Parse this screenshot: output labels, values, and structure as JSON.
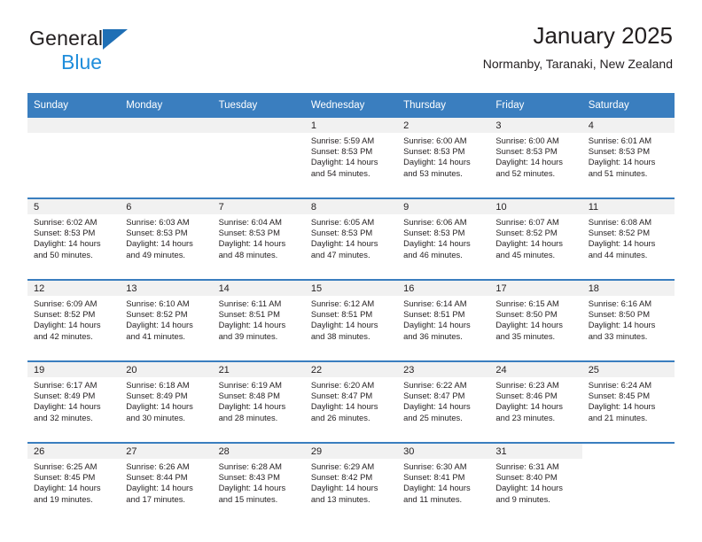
{
  "brand": {
    "line1": "General",
    "line2": "Blue",
    "triangle_color": "#1f6fb5",
    "blue_text_color": "#1f8ddb"
  },
  "header": {
    "title": "January 2025",
    "location": "Normanby, Taranaki, New Zealand"
  },
  "theme": {
    "header_blue": "#3a7ebf",
    "daynum_band": "#f1f1f1",
    "divider_blue": "#3a7ebf"
  },
  "weekday_headers": [
    "Sunday",
    "Monday",
    "Tuesday",
    "Wednesday",
    "Thursday",
    "Friday",
    "Saturday"
  ],
  "labels": {
    "sunrise_prefix": "Sunrise:",
    "sunset_prefix": "Sunset:",
    "daylight_prefix": "Daylight:"
  },
  "weeks": [
    [
      {
        "empty": true
      },
      {
        "empty": true
      },
      {
        "empty": true
      },
      {
        "day": "1",
        "sunrise": "Sunrise: 5:59 AM",
        "sunset": "Sunset: 8:53 PM",
        "daylight_1": "Daylight: 14 hours",
        "daylight_2": "and 54 minutes."
      },
      {
        "day": "2",
        "sunrise": "Sunrise: 6:00 AM",
        "sunset": "Sunset: 8:53 PM",
        "daylight_1": "Daylight: 14 hours",
        "daylight_2": "and 53 minutes."
      },
      {
        "day": "3",
        "sunrise": "Sunrise: 6:00 AM",
        "sunset": "Sunset: 8:53 PM",
        "daylight_1": "Daylight: 14 hours",
        "daylight_2": "and 52 minutes."
      },
      {
        "day": "4",
        "sunrise": "Sunrise: 6:01 AM",
        "sunset": "Sunset: 8:53 PM",
        "daylight_1": "Daylight: 14 hours",
        "daylight_2": "and 51 minutes."
      }
    ],
    [
      {
        "day": "5",
        "sunrise": "Sunrise: 6:02 AM",
        "sunset": "Sunset: 8:53 PM",
        "daylight_1": "Daylight: 14 hours",
        "daylight_2": "and 50 minutes."
      },
      {
        "day": "6",
        "sunrise": "Sunrise: 6:03 AM",
        "sunset": "Sunset: 8:53 PM",
        "daylight_1": "Daylight: 14 hours",
        "daylight_2": "and 49 minutes."
      },
      {
        "day": "7",
        "sunrise": "Sunrise: 6:04 AM",
        "sunset": "Sunset: 8:53 PM",
        "daylight_1": "Daylight: 14 hours",
        "daylight_2": "and 48 minutes."
      },
      {
        "day": "8",
        "sunrise": "Sunrise: 6:05 AM",
        "sunset": "Sunset: 8:53 PM",
        "daylight_1": "Daylight: 14 hours",
        "daylight_2": "and 47 minutes."
      },
      {
        "day": "9",
        "sunrise": "Sunrise: 6:06 AM",
        "sunset": "Sunset: 8:53 PM",
        "daylight_1": "Daylight: 14 hours",
        "daylight_2": "and 46 minutes."
      },
      {
        "day": "10",
        "sunrise": "Sunrise: 6:07 AM",
        "sunset": "Sunset: 8:52 PM",
        "daylight_1": "Daylight: 14 hours",
        "daylight_2": "and 45 minutes."
      },
      {
        "day": "11",
        "sunrise": "Sunrise: 6:08 AM",
        "sunset": "Sunset: 8:52 PM",
        "daylight_1": "Daylight: 14 hours",
        "daylight_2": "and 44 minutes."
      }
    ],
    [
      {
        "day": "12",
        "sunrise": "Sunrise: 6:09 AM",
        "sunset": "Sunset: 8:52 PM",
        "daylight_1": "Daylight: 14 hours",
        "daylight_2": "and 42 minutes."
      },
      {
        "day": "13",
        "sunrise": "Sunrise: 6:10 AM",
        "sunset": "Sunset: 8:52 PM",
        "daylight_1": "Daylight: 14 hours",
        "daylight_2": "and 41 minutes."
      },
      {
        "day": "14",
        "sunrise": "Sunrise: 6:11 AM",
        "sunset": "Sunset: 8:51 PM",
        "daylight_1": "Daylight: 14 hours",
        "daylight_2": "and 39 minutes."
      },
      {
        "day": "15",
        "sunrise": "Sunrise: 6:12 AM",
        "sunset": "Sunset: 8:51 PM",
        "daylight_1": "Daylight: 14 hours",
        "daylight_2": "and 38 minutes."
      },
      {
        "day": "16",
        "sunrise": "Sunrise: 6:14 AM",
        "sunset": "Sunset: 8:51 PM",
        "daylight_1": "Daylight: 14 hours",
        "daylight_2": "and 36 minutes."
      },
      {
        "day": "17",
        "sunrise": "Sunrise: 6:15 AM",
        "sunset": "Sunset: 8:50 PM",
        "daylight_1": "Daylight: 14 hours",
        "daylight_2": "and 35 minutes."
      },
      {
        "day": "18",
        "sunrise": "Sunrise: 6:16 AM",
        "sunset": "Sunset: 8:50 PM",
        "daylight_1": "Daylight: 14 hours",
        "daylight_2": "and 33 minutes."
      }
    ],
    [
      {
        "day": "19",
        "sunrise": "Sunrise: 6:17 AM",
        "sunset": "Sunset: 8:49 PM",
        "daylight_1": "Daylight: 14 hours",
        "daylight_2": "and 32 minutes."
      },
      {
        "day": "20",
        "sunrise": "Sunrise: 6:18 AM",
        "sunset": "Sunset: 8:49 PM",
        "daylight_1": "Daylight: 14 hours",
        "daylight_2": "and 30 minutes."
      },
      {
        "day": "21",
        "sunrise": "Sunrise: 6:19 AM",
        "sunset": "Sunset: 8:48 PM",
        "daylight_1": "Daylight: 14 hours",
        "daylight_2": "and 28 minutes."
      },
      {
        "day": "22",
        "sunrise": "Sunrise: 6:20 AM",
        "sunset": "Sunset: 8:47 PM",
        "daylight_1": "Daylight: 14 hours",
        "daylight_2": "and 26 minutes."
      },
      {
        "day": "23",
        "sunrise": "Sunrise: 6:22 AM",
        "sunset": "Sunset: 8:47 PM",
        "daylight_1": "Daylight: 14 hours",
        "daylight_2": "and 25 minutes."
      },
      {
        "day": "24",
        "sunrise": "Sunrise: 6:23 AM",
        "sunset": "Sunset: 8:46 PM",
        "daylight_1": "Daylight: 14 hours",
        "daylight_2": "and 23 minutes."
      },
      {
        "day": "25",
        "sunrise": "Sunrise: 6:24 AM",
        "sunset": "Sunset: 8:45 PM",
        "daylight_1": "Daylight: 14 hours",
        "daylight_2": "and 21 minutes."
      }
    ],
    [
      {
        "day": "26",
        "sunrise": "Sunrise: 6:25 AM",
        "sunset": "Sunset: 8:45 PM",
        "daylight_1": "Daylight: 14 hours",
        "daylight_2": "and 19 minutes."
      },
      {
        "day": "27",
        "sunrise": "Sunrise: 6:26 AM",
        "sunset": "Sunset: 8:44 PM",
        "daylight_1": "Daylight: 14 hours",
        "daylight_2": "and 17 minutes."
      },
      {
        "day": "28",
        "sunrise": "Sunrise: 6:28 AM",
        "sunset": "Sunset: 8:43 PM",
        "daylight_1": "Daylight: 14 hours",
        "daylight_2": "and 15 minutes."
      },
      {
        "day": "29",
        "sunrise": "Sunrise: 6:29 AM",
        "sunset": "Sunset: 8:42 PM",
        "daylight_1": "Daylight: 14 hours",
        "daylight_2": "and 13 minutes."
      },
      {
        "day": "30",
        "sunrise": "Sunrise: 6:30 AM",
        "sunset": "Sunset: 8:41 PM",
        "daylight_1": "Daylight: 14 hours",
        "daylight_2": "and 11 minutes."
      },
      {
        "day": "31",
        "sunrise": "Sunrise: 6:31 AM",
        "sunset": "Sunset: 8:40 PM",
        "daylight_1": "Daylight: 14 hours",
        "daylight_2": "and 9 minutes."
      },
      {
        "empty": true,
        "no_band": true
      }
    ]
  ]
}
